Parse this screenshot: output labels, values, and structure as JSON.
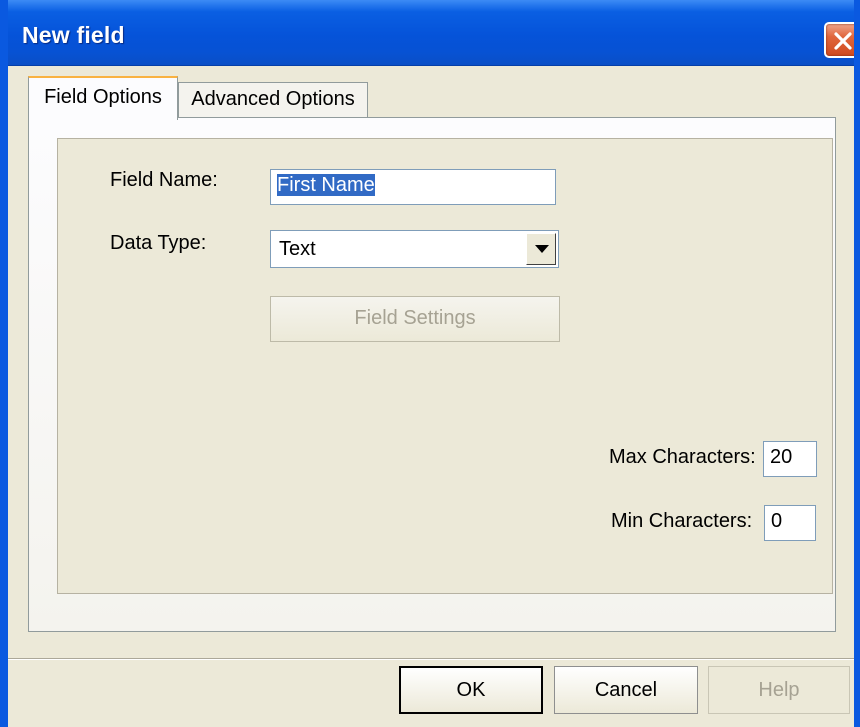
{
  "window": {
    "title": "New field"
  },
  "tabs": [
    {
      "label": "Field Options",
      "active": true
    },
    {
      "label": "Advanced Options",
      "active": false
    }
  ],
  "field_name": {
    "label": "Field Name:",
    "value": "First Name"
  },
  "data_type": {
    "label": "Data Type:",
    "value": "Text"
  },
  "field_settings": {
    "label": "Field Settings",
    "enabled": false
  },
  "max_characters": {
    "label": "Max Characters:",
    "value": "20"
  },
  "min_characters": {
    "label": "Min Characters:",
    "value": "0"
  },
  "buttons": {
    "ok": "OK",
    "cancel": "Cancel",
    "help": "Help"
  },
  "colors": {
    "titlebar": "#0553d9",
    "dialog_bg": "#ece9d8",
    "selection": "#316ac5",
    "active_tab_accent": "#f9b241",
    "close_button": "#e0663c"
  },
  "icons": {
    "close": "close-icon",
    "dropdown": "chevron-down-icon"
  }
}
